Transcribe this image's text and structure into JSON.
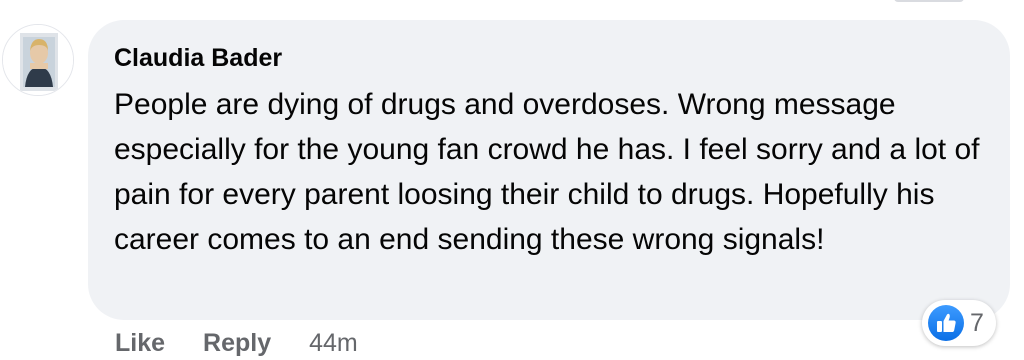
{
  "comment": {
    "author": "Claudia Bader",
    "text": "People are dying of drugs and overdoses. Wrong message especially for the young fan crowd he has. I feel sorry and a lot of pain for every parent loosing their child to drugs. Hopefully his career comes to an end sending these wrong signals!",
    "avatar_icon": "profile-photo",
    "reactions": {
      "icon": "thumbs-up-icon",
      "count": "7",
      "color": "#1877f2"
    },
    "actions": {
      "like_label": "Like",
      "reply_label": "Reply",
      "timestamp": "44m"
    }
  },
  "colors": {
    "bubble_bg": "#f0f2f5",
    "secondary_text": "#65676b",
    "primary_text": "#050505",
    "accent": "#1877f2"
  }
}
